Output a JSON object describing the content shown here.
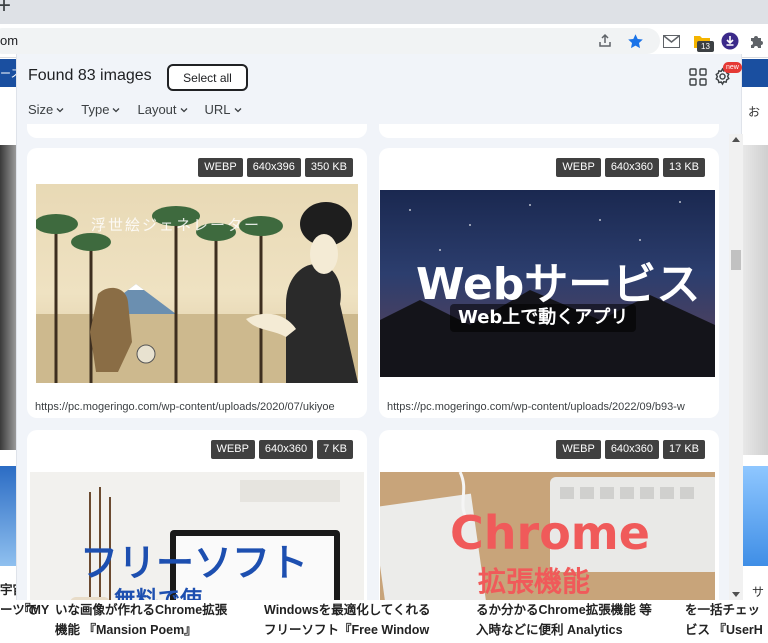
{
  "browser": {
    "tab_plus": "+",
    "address": "om",
    "ext_badge_count": "13"
  },
  "page": {
    "strip_text": "ース",
    "right_label_top": "お",
    "right_label_bottom": "サ",
    "bottom_cols": [
      {
        "line1": "宇宙",
        "line2": "ーツで",
        "line3": "『MY"
      },
      {
        "line1": "いな画像が作れるChrome拡張",
        "line2": "機能 『Mansion Poem』"
      },
      {
        "line1": "Windowsを最適化してくれる",
        "line2": "フリーソフト『Free Window"
      },
      {
        "line1": "るか分かるChrome拡張機能 等",
        "line2": "入時などに便利 Analytics"
      },
      {
        "line1": "を一括チェッ",
        "line2": "ビス 『UserH"
      }
    ]
  },
  "popup": {
    "found_text": "Found 83 images",
    "select_all": "Select all",
    "new_badge": "new",
    "filters": [
      "Size",
      "Type",
      "Layout",
      "URL"
    ],
    "cards": [
      {
        "tags": [
          "WEBP",
          "640x396",
          "350 KB"
        ],
        "url": "https://pc.mogeringo.com/wp-content/uploads/2020/07/ukiyoe",
        "image_text": "浮世絵ジェネレーター"
      },
      {
        "tags": [
          "WEBP",
          "640x360",
          "13 KB"
        ],
        "url": "https://pc.mogeringo.com/wp-content/uploads/2022/09/b93-w",
        "image_title": "Webサービス",
        "image_subtitle": "Web上で動くアプリ"
      },
      {
        "tags": [
          "WEBP",
          "640x360",
          "7 KB"
        ],
        "image_title": "フリーソフト",
        "image_subtitle": "無料で使"
      },
      {
        "tags": [
          "WEBP",
          "640x360",
          "17 KB"
        ],
        "image_title": "Chrome",
        "image_subtitle": "拡張機能"
      }
    ]
  },
  "colors": {
    "popup_bg": "#f1f4f9",
    "tag_bg": "#404040",
    "chrome_blue": "#1a73e8",
    "strip_blue": "#1a4fa0"
  }
}
